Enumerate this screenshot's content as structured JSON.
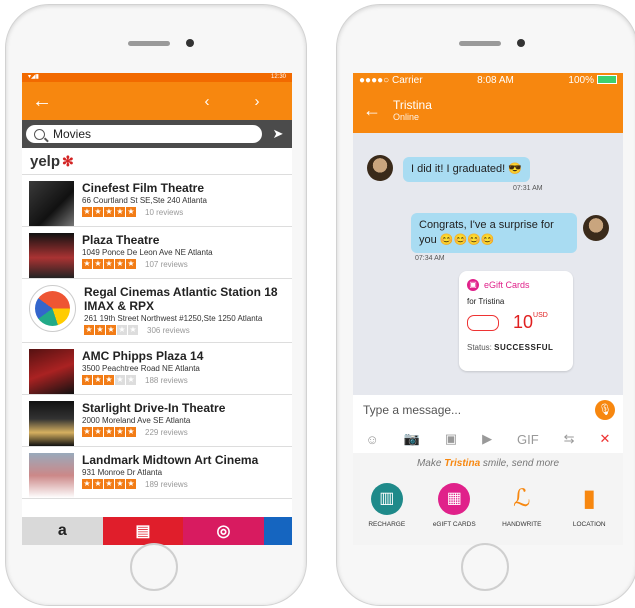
{
  "left": {
    "status_time": "12:30",
    "search_query": "Movies",
    "yelp_logo": "yelp",
    "results": [
      {
        "name": "Cinefest Film Theatre",
        "address": "66 Courtland St SE,Ste 240 Atlanta",
        "stars": 5,
        "reviews": "10 reviews"
      },
      {
        "name": "Plaza Theatre",
        "address": "1049 Ponce De Leon Ave NE Atlanta",
        "stars": 5,
        "reviews": "107 reviews"
      },
      {
        "name": "Regal Cinemas Atlantic Station 18 IMAX & RPX",
        "address": "261 19th Street Northwest #1250,Ste 1250 Atlanta",
        "stars": 3,
        "reviews": "306 reviews"
      },
      {
        "name": "AMC Phipps Plaza 14",
        "address": "3500 Peachtree Road NE Atlanta",
        "stars": 3,
        "reviews": "188 reviews"
      },
      {
        "name": "Starlight Drive-In Theatre",
        "address": "2000 Moreland Ave SE Atlanta",
        "stars": 5,
        "reviews": "229 reviews"
      },
      {
        "name": "Landmark Midtown Art Cinema",
        "address": "931 Monroe Dr Atlanta",
        "stars": 5,
        "reviews": "189 reviews"
      }
    ],
    "dock": [
      "a",
      "",
      "",
      ""
    ],
    "accent": "#f7870f"
  },
  "right": {
    "carrier": "Carrier",
    "time": "8:08 AM",
    "battery": "100%",
    "contact_name": "Tristina",
    "contact_status": "Online",
    "msg1": "I did it! I graduated! 😎",
    "msg1_time": "07:31 AM",
    "msg2": "Congrats, I've a surprise for you 😊😊😊😊",
    "msg2_time": "07:34 AM",
    "gift": {
      "title": "eGift Cards",
      "for": "for Tristina",
      "amount": "10",
      "currency": "USD",
      "status_label": "Status:",
      "status_value": "SUCCESSFUL"
    },
    "input_placeholder": "Type a message...",
    "tools": [
      "☺",
      "📷",
      "▣",
      "▶",
      "GIF",
      "⇆",
      "✕"
    ],
    "prompt_pre": "Make ",
    "prompt_name": "Tristina",
    "prompt_post": " smile, send more",
    "actions": [
      {
        "label": "RECHARGE",
        "color": "#1f8a8a",
        "icon": "▥"
      },
      {
        "label": "eGIFT CARDS",
        "color": "#e0218a",
        "icon": "▦"
      },
      {
        "label": "HANDWRITE",
        "color": "#f7870f",
        "icon": "ℒ"
      },
      {
        "label": "LOCATION",
        "color": "#f7870f",
        "icon": "▮"
      }
    ]
  }
}
